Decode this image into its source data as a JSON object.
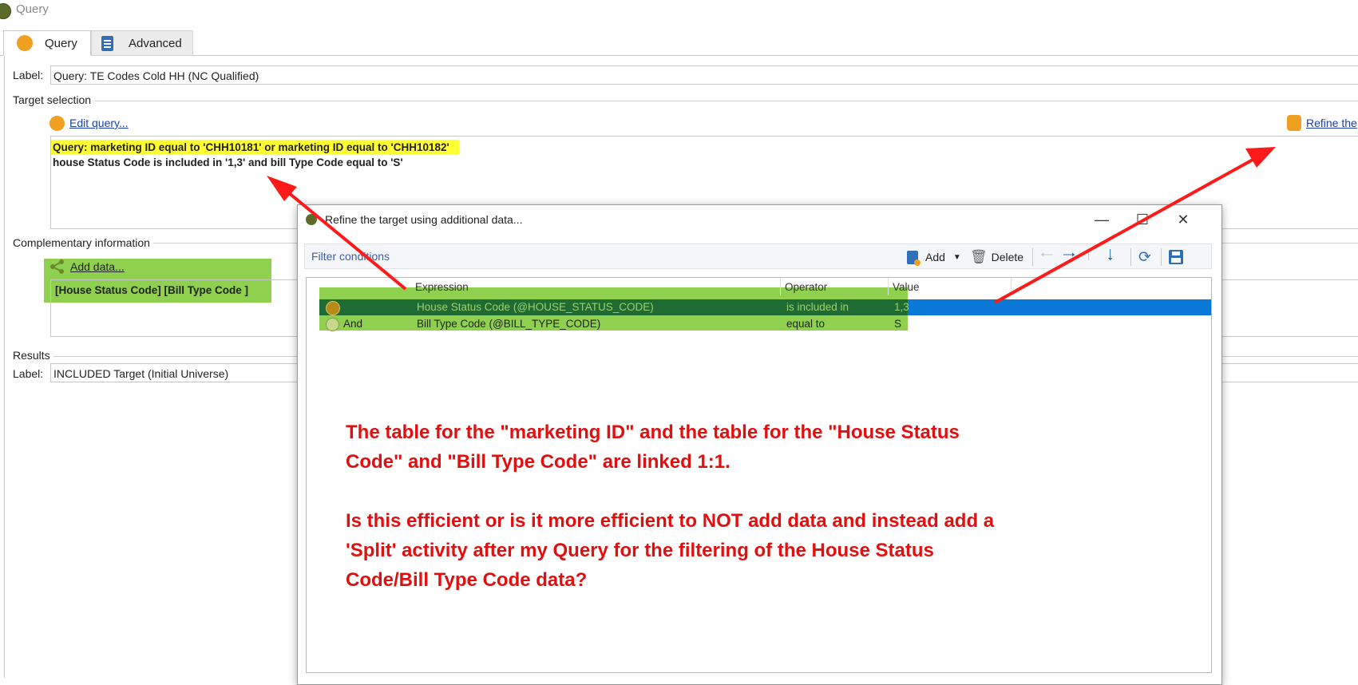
{
  "window": {
    "title": "Query"
  },
  "tabs": [
    {
      "label": "Query"
    },
    {
      "label": "Advanced"
    }
  ],
  "label_field": {
    "label": "Label:",
    "value": "Query: TE Codes Cold HH (NC Qualified)"
  },
  "target_selection": {
    "title": "Target selection",
    "edit_link": "Edit query...",
    "refine_link": "Refine the",
    "query_line1": "Query: marketing ID equal to 'CHH10181' or marketing ID equal to 'CHH10182'",
    "query_line2": "house Status Code is included in '1,3' and bill Type Code equal to 'S'"
  },
  "complementary": {
    "title": "Complementary information",
    "add_link": "Add data...",
    "fields_text": "[House Status Code]  [Bill Type Code ]"
  },
  "results": {
    "title": "Results",
    "label": "Label:",
    "value": "INCLUDED Target (Initial Universe)"
  },
  "dialog": {
    "title": "Refine the target using additional data...",
    "toolbar": {
      "filter_label": "Filter conditions",
      "add_label": "Add",
      "delete_label": "Delete"
    },
    "columns": {
      "expression": "Expression",
      "operator": "Operator",
      "value": "Value"
    },
    "rows": [
      {
        "logic": "",
        "expression": "House Status Code (@HOUSE_STATUS_CODE)",
        "operator": "is included in",
        "value": "1,3"
      },
      {
        "logic": "And",
        "expression": "Bill Type Code  (@BILL_TYPE_CODE)",
        "operator": "equal to",
        "value": "S"
      }
    ]
  },
  "annotation": {
    "paragraph1": "The table for the \"marketing ID\" and the table for the \"House Status Code\" and \"Bill Type Code\" are linked 1:1.",
    "paragraph2": "Is this efficient or is it more efficient to NOT add data and instead add a 'Split' activity after my Query for the filtering of the House Status Code/Bill Type Code data?"
  },
  "colors": {
    "highlight_yellow": "#ffff33",
    "highlight_green": "#8fd14f",
    "selection_blue": "#0a78d7",
    "annotation_red": "#e01010",
    "link_blue": "#1a3fb0"
  }
}
